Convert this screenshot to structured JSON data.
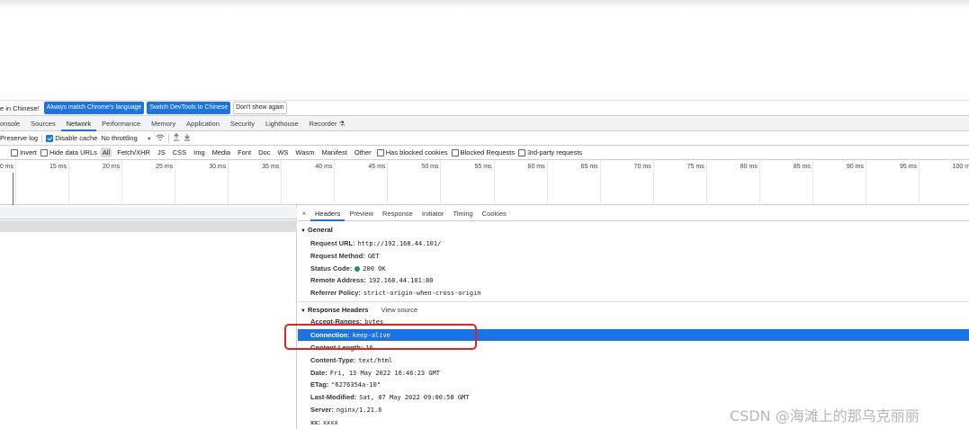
{
  "infobar": {
    "message": "e in Chinese!",
    "buttons": [
      "Always match Chrome's language",
      "Switch DevTools to Chinese",
      "Don't show again"
    ],
    "colors": {
      "primary": "#1a73e8"
    }
  },
  "tabs": [
    {
      "label": "onsole",
      "active": false
    },
    {
      "label": "Sources",
      "active": false
    },
    {
      "label": "Network",
      "active": true
    },
    {
      "label": "Performance",
      "active": false
    },
    {
      "label": "Memory",
      "active": false
    },
    {
      "label": "Application",
      "active": false
    },
    {
      "label": "Security",
      "active": false
    },
    {
      "label": "Lighthouse",
      "active": false
    },
    {
      "label": "Recorder",
      "active": false
    }
  ],
  "toolbar": {
    "preserve_log": "Preserve log",
    "disable_cache": "Disable cache",
    "throttling": "No throttling",
    "throttle_arrow": "▼",
    "wifi_icon": "wifi-icon",
    "upload_icon": "upload-icon",
    "download_icon": "download-icon"
  },
  "filterbar": {
    "invert": "Invert",
    "hide_data_urls": "Hide data URLs",
    "types": [
      "All",
      "Fetch/XHR",
      "JS",
      "CSS",
      "Img",
      "Media",
      "Font",
      "Doc",
      "WS",
      "Wasm",
      "Manifest",
      "Other"
    ],
    "has_blocked_cookies": "Has blocked cookies",
    "blocked_requests": "Blocked Requests",
    "third_party": "3rd-party requests"
  },
  "timeline": {
    "ticks": [
      "0 ms",
      "15 ms",
      "20 ms",
      "25 ms",
      "30 ms",
      "35 ms",
      "40 ms",
      "45 ms",
      "50 ms",
      "55 ms",
      "60 ms",
      "65 ms",
      "70 ms",
      "75 ms",
      "80 ms",
      "85 ms",
      "90 ms",
      "95 ms",
      "100 m"
    ]
  },
  "details": {
    "tabs": [
      {
        "label": "Headers",
        "active": true
      },
      {
        "label": "Preview",
        "active": false
      },
      {
        "label": "Response",
        "active": false
      },
      {
        "label": "Initiator",
        "active": false
      },
      {
        "label": "Timing",
        "active": false
      },
      {
        "label": "Cookies",
        "active": false
      }
    ],
    "close": "×",
    "general": {
      "title": "General",
      "rows": [
        {
          "key": "Request URL:",
          "value": "http://192.168.44.101/"
        },
        {
          "key": "Request Method:",
          "value": "GET"
        },
        {
          "key": "Status Code:",
          "value": "200 OK"
        },
        {
          "key": "Remote Address:",
          "value": "192.168.44.101:80"
        },
        {
          "key": "Referrer Policy:",
          "value": "strict-origin-when-cross-origin"
        }
      ]
    },
    "response_headers": {
      "title": "Response Headers",
      "view_source": "View source",
      "rows": [
        {
          "key": "Accept-Ranges:",
          "value": "bytes"
        },
        {
          "key": "Connection:",
          "value": "keep-alive"
        },
        {
          "key": "Content-Length:",
          "value": "16"
        },
        {
          "key": "Content-Type:",
          "value": "text/html"
        },
        {
          "key": "Date:",
          "value": "Fri, 13 May 2022 16:46:23 GMT"
        },
        {
          "key": "ETag:",
          "value": "\"6276354a-10\""
        },
        {
          "key": "Last-Modified:",
          "value": "Sat, 07 May 2022 09:00:58 GMT"
        },
        {
          "key": "Server:",
          "value": "nginx/1.21.6"
        },
        {
          "key": "xx:",
          "value": "xxxx"
        }
      ]
    }
  },
  "watermark": "CSDN @海滩上的那乌克丽丽",
  "colors": {
    "accent": "#1a73e8",
    "highlight": "#e5221c",
    "status_ok": "#0f9d58"
  }
}
